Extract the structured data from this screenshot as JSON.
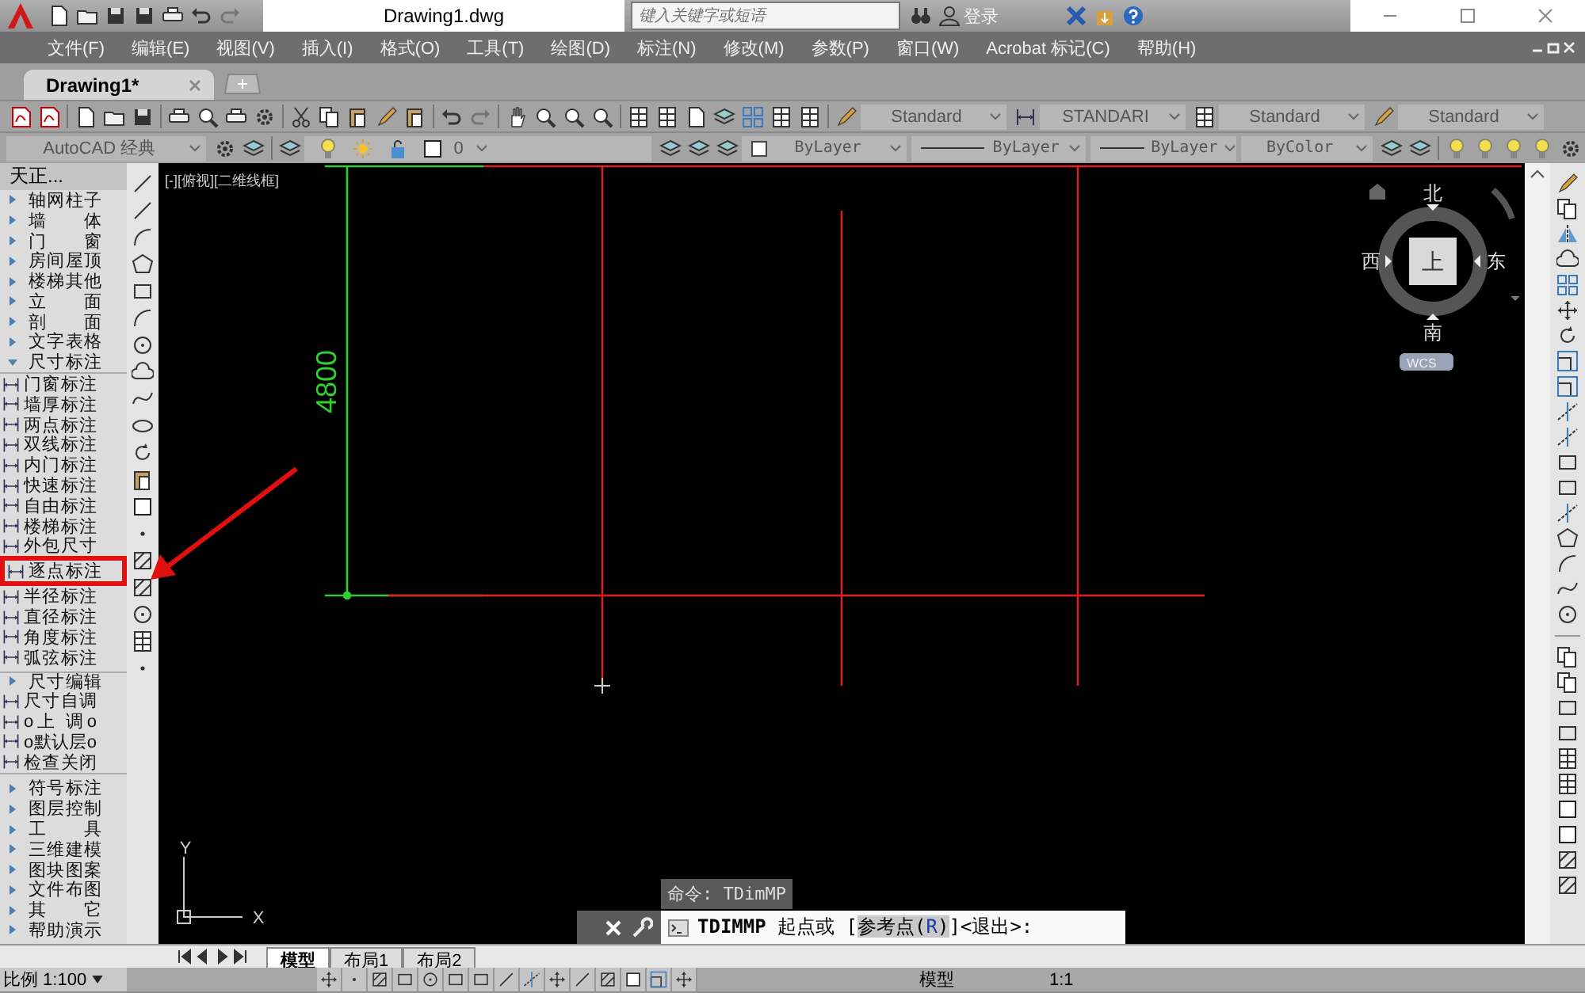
{
  "title_bar": {
    "document": "Drawing1.dwg",
    "search": {
      "placeholder": "键入关键字或短语"
    },
    "sign_in": "登录"
  },
  "menu": [
    "文件(F)",
    "编辑(E)",
    "视图(V)",
    "插入(I)",
    "格式(O)",
    "工具(T)",
    "绘图(D)",
    "标注(N)",
    "修改(M)",
    "参数(P)",
    "窗口(W)",
    "Acrobat 标记(C)",
    "帮助(H)"
  ],
  "document_tabs": [
    {
      "label": "Drawing1*",
      "selected": true
    }
  ],
  "style_toolbar": {
    "text_style": "Standard",
    "dim_style": "STANDARI",
    "table_style": "Standard",
    "multileader_style": "Standard"
  },
  "properties_toolbar": {
    "workspace": "AutoCAD 经典",
    "layer": "0",
    "object_color": "ByLayer",
    "linetype": "ByLayer",
    "lineweight": "ByLayer",
    "plot_style": "ByColor"
  },
  "tool_palette": {
    "title": "天正...",
    "items": [
      {
        "kind": "group",
        "label": "轴网柱子",
        "expanded": false
      },
      {
        "kind": "group",
        "label": "墙 体",
        "expanded": false
      },
      {
        "kind": "group",
        "label": "门 窗",
        "expanded": false
      },
      {
        "kind": "group",
        "label": "房间屋顶",
        "expanded": false
      },
      {
        "kind": "group",
        "label": "楼梯其他",
        "expanded": false
      },
      {
        "kind": "group",
        "label": "立 面",
        "expanded": false
      },
      {
        "kind": "group",
        "label": "剖 面",
        "expanded": false
      },
      {
        "kind": "group",
        "label": "文字表格",
        "expanded": false
      },
      {
        "kind": "group",
        "label": "尺寸标注",
        "expanded": true,
        "children": [
          {
            "kind": "command",
            "label": "门窗标注",
            "marked": false
          },
          {
            "kind": "command",
            "label": "墙厚标注",
            "marked": false
          },
          {
            "kind": "command",
            "label": "两点标注",
            "marked": false
          },
          {
            "kind": "command",
            "label": "双线标注",
            "marked": false
          },
          {
            "kind": "command",
            "label": "内门标注",
            "marked": false
          },
          {
            "kind": "command",
            "label": "快速标注",
            "marked": false
          },
          {
            "kind": "command",
            "label": "自由标注",
            "marked": false
          },
          {
            "kind": "command",
            "label": "楼梯标注",
            "marked": false
          },
          {
            "kind": "command",
            "label": "外包尺寸",
            "marked": false
          },
          {
            "kind": "command",
            "label": "逐点标注",
            "marked": true
          },
          {
            "kind": "command",
            "label": "半径标注",
            "marked": false
          },
          {
            "kind": "command",
            "label": "直径标注",
            "marked": false
          },
          {
            "kind": "command",
            "label": "角度标注",
            "marked": false
          },
          {
            "kind": "command",
            "label": "弧弦标注",
            "marked": false
          },
          {
            "kind": "group",
            "label": "尺寸编辑",
            "expanded": false
          },
          {
            "kind": "command",
            "label": "尺寸自调",
            "marked": false
          },
          {
            "kind": "command",
            "label": "o上 调o",
            "marked": false
          },
          {
            "kind": "command",
            "label": "o默认层o",
            "marked": false
          },
          {
            "kind": "command",
            "label": "检查关闭",
            "marked": false
          }
        ]
      },
      {
        "kind": "group",
        "label": "符号标注",
        "expanded": false
      },
      {
        "kind": "group",
        "label": "图层控制",
        "expanded": false
      },
      {
        "kind": "group",
        "label": "工 具",
        "expanded": false
      },
      {
        "kind": "group",
        "label": "三维建模",
        "expanded": false
      },
      {
        "kind": "group",
        "label": "图块图案",
        "expanded": false
      },
      {
        "kind": "group",
        "label": "文件布图",
        "expanded": false
      },
      {
        "kind": "group",
        "label": "其 它",
        "expanded": false
      },
      {
        "kind": "group",
        "label": "帮助演示",
        "expanded": false
      }
    ]
  },
  "viewport": {
    "label": "[-][俯视][二维线框]",
    "dimension": "4800"
  },
  "view_cube": {
    "north": "北",
    "south": "南",
    "east": "东",
    "west": "西",
    "face": "上",
    "ucs": "WCS"
  },
  "ucs_icon": {
    "x": "X",
    "y": "Y"
  },
  "command": {
    "history": "命令: TDimMP",
    "name": "TDIMMP",
    "prompt": "起点或 [",
    "option": [
      "参考点(",
      "R",
      ")"
    ],
    "suffix": "]<退出>:"
  },
  "layout_tabs": [
    {
      "label": "模型",
      "selected": true
    },
    {
      "label": "布局1",
      "selected": false
    },
    {
      "label": "布局2",
      "selected": false
    }
  ],
  "status_bar": {
    "scale": "比例 1:100",
    "space": "模型",
    "annotation_scale": "1:1"
  }
}
